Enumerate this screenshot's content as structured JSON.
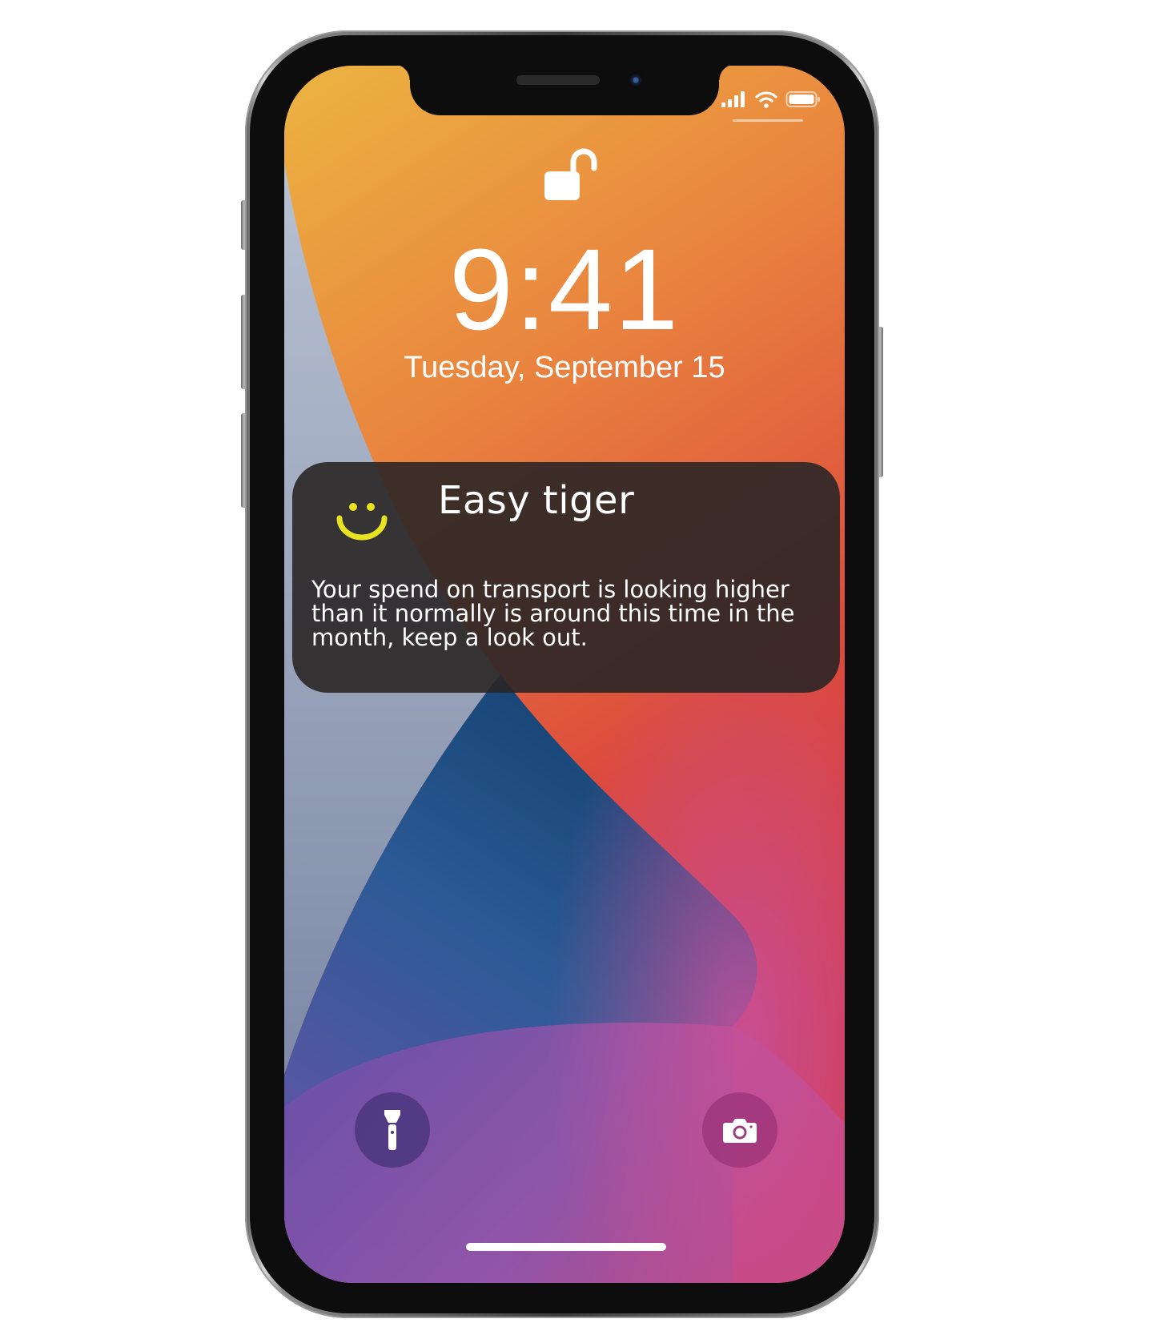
{
  "lock_screen": {
    "time": "9:41",
    "date": "Tuesday, September 15"
  },
  "notification": {
    "title": "Easy tiger",
    "body": "Your spend on transport is looking higher than it normally is around this time in the month, keep a look out.",
    "icon": "smiley-icon",
    "accent_color": "#e7e321"
  },
  "status_bar": {
    "icons": [
      "signal-bars-icon",
      "wifi-icon",
      "battery-icon"
    ]
  },
  "quick_actions": {
    "left": "flashlight-icon",
    "right": "camera-icon"
  },
  "wallpaper_colors": {
    "yellow": "#ebb23f",
    "orange": "#e9773f",
    "red": "#d8393e",
    "pink": "#c84a8a",
    "blue": "#1f4f8a",
    "purple": "#7a56b0",
    "gray": "#a8b2c8"
  }
}
